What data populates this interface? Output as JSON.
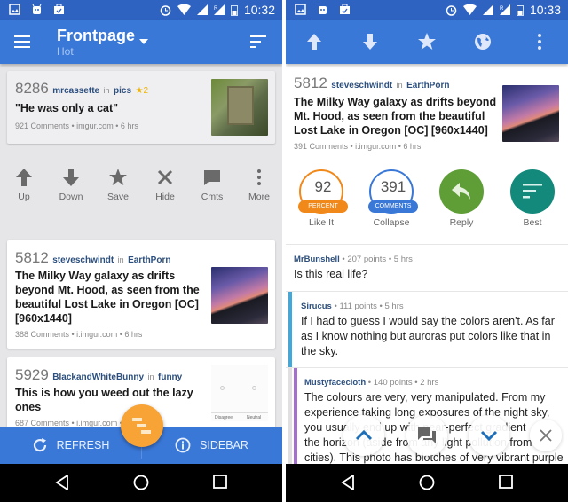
{
  "left": {
    "status": {
      "time": "10:32"
    },
    "appbar": {
      "title": "Frontpage",
      "subtitle": "Hot"
    },
    "posts": [
      {
        "score": "8286",
        "author": "mrcassette",
        "in": "in",
        "subreddit": "pics",
        "gilded": "★2",
        "title": "\"He was only a cat\"",
        "info": "921 Comments • imgur.com • 6 hrs",
        "thumbnail": "gravestone-photo"
      },
      {
        "score": "5812",
        "author": "steveschwindt",
        "in": "in",
        "subreddit": "EarthPorn",
        "title_lines": [
          "The Milky Way galaxy as drifts",
          "beyond Mt. Hood, as seen from the",
          "beautiful Lost Lake in Oregon [OC]",
          "[960x1440]"
        ],
        "info": "388 Comments • i.imgur.com • 6 hrs",
        "thumbnail": "milky-way-photo"
      },
      {
        "score": "5929",
        "author": "BlackandWhiteBunny",
        "in": "in",
        "subreddit": "funny",
        "title_lines": [
          "This is how you weed out the lazy",
          "ones"
        ],
        "info": "687 Comments • i.imgur.com • 6 hrs",
        "thumbnail": "survey-scale-image",
        "thumb_labels": [
          "Disagree",
          "Neutral"
        ]
      }
    ],
    "actions": [
      {
        "icon": "arrow-up-icon",
        "label": "Up"
      },
      {
        "icon": "arrow-down-icon",
        "label": "Down"
      },
      {
        "icon": "star-icon",
        "label": "Save"
      },
      {
        "icon": "close-icon",
        "label": "Hide"
      },
      {
        "icon": "comment-icon",
        "label": "Cmts"
      },
      {
        "icon": "more-vert-icon",
        "label": "More"
      }
    ],
    "bottom": {
      "refresh": "REFRESH",
      "sidebar": "SIDEBAR"
    }
  },
  "right": {
    "status": {
      "time": "10:33"
    },
    "toolbar": [
      "arrow-up-icon",
      "arrow-down-icon",
      "star-icon",
      "globe-icon",
      "more-vert-icon"
    ],
    "post": {
      "score": "5812",
      "author": "steveschwindt",
      "in": "in",
      "subreddit": "EarthPorn",
      "title_lines": [
        "The Milky Way galaxy as drifts beyond",
        "Mt. Hood, as seen from the beautiful",
        "Lost Lake in Oregon [OC] [960x1440]"
      ],
      "info": "391 Comments • i.imgur.com • 6 hrs"
    },
    "stats": [
      {
        "value": "92",
        "tag": "PERCENT",
        "label": "Like It",
        "color": "#f0881a"
      },
      {
        "value": "391",
        "tag": "COMMENTS",
        "label": "Collapse",
        "color": "#3a78d8"
      },
      {
        "icon": "reply-icon",
        "label": "Reply",
        "color": "#5f9e37"
      },
      {
        "icon": "sort-icon",
        "label": "Best",
        "color": "#12897a"
      }
    ],
    "comments": [
      {
        "user": "MrBunshell",
        "meta": " • 207 points • 5 hrs",
        "lines": [
          "Is this real life?"
        ]
      },
      {
        "user": "Sirucus",
        "meta": " • 111 points • 5 hrs",
        "lines": [
          "If I had to guess I would say the colors aren't. As far",
          "as I know nothing but auroras put colors like that in",
          "the sky."
        ],
        "bar_color": "#3fa9dd"
      },
      {
        "user": "Mustyfacecloth",
        "meta": " • 140 points • 2 hrs",
        "lines": [
          "The colours are very, very manipulated. From my",
          "experience taking long exposures of the night sky,",
          "you usually end up with near-perfect gradient",
          "the horizon (aside from any light pollution from",
          "cities). This photo has blotches of very vibrant purple"
        ],
        "bar_color": "#a46fd1"
      }
    ],
    "float_buttons": [
      "chevron-up-icon",
      "comments-icon",
      "chevron-down-icon",
      "close-icon"
    ]
  },
  "colors": {
    "primary": "#3a78d8",
    "status": "#2f63c2",
    "fab": "#f7a336"
  }
}
